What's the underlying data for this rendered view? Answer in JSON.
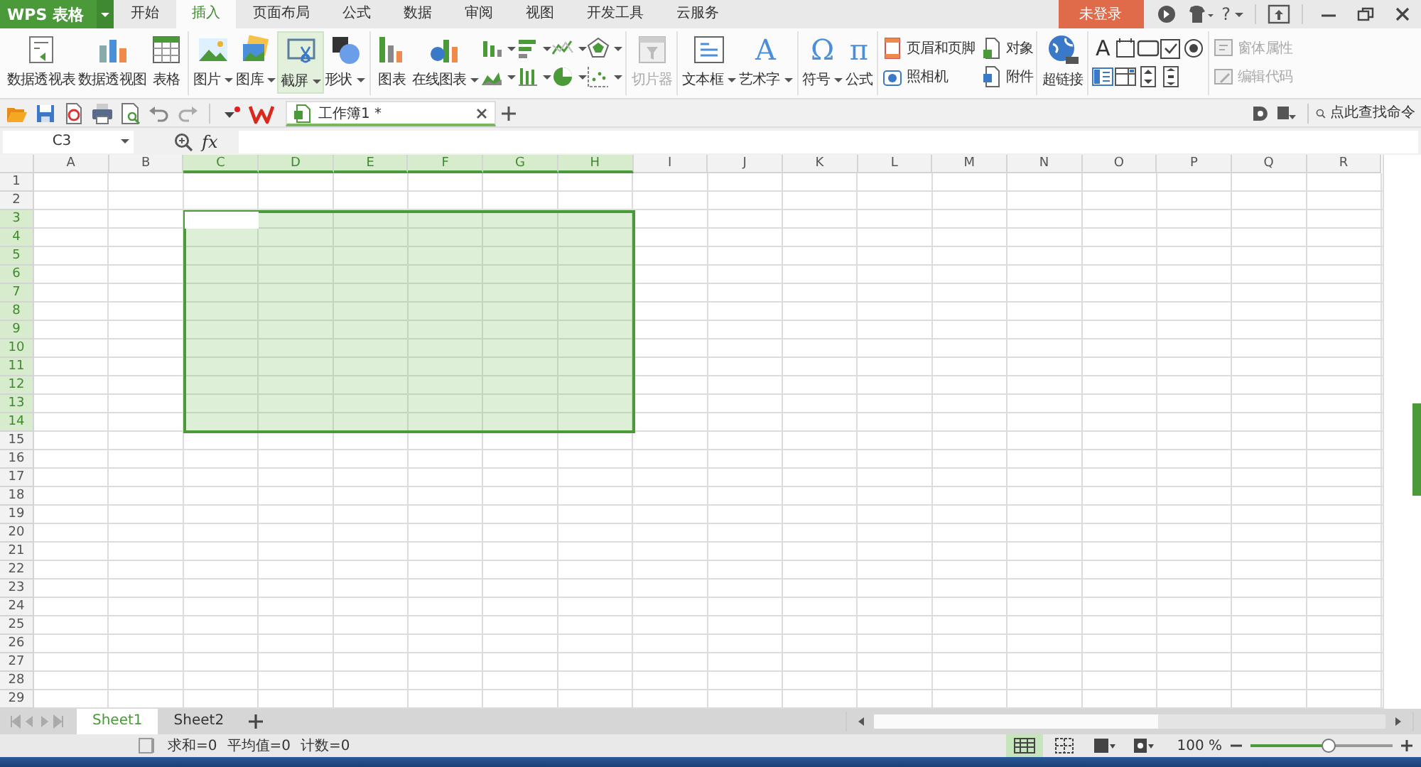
{
  "app": {
    "title": "WPS 表格",
    "login": "未登录",
    "help": "?"
  },
  "menu_tabs": [
    {
      "label": "开始",
      "selected": false
    },
    {
      "label": "插入",
      "selected": true
    },
    {
      "label": "页面布局",
      "selected": false
    },
    {
      "label": "公式",
      "selected": false
    },
    {
      "label": "数据",
      "selected": false
    },
    {
      "label": "审阅",
      "selected": false
    },
    {
      "label": "视图",
      "selected": false
    },
    {
      "label": "开发工具",
      "selected": false
    },
    {
      "label": "云服务",
      "selected": false
    }
  ],
  "ribbon": [
    {
      "items": [
        {
          "kind": "large",
          "label": "数据透视表",
          "dropdown": false,
          "pressed": false,
          "disabled": false
        },
        {
          "kind": "large",
          "label": "数据透视图",
          "dropdown": false,
          "pressed": false,
          "disabled": false
        },
        {
          "kind": "large",
          "label": "表格",
          "dropdown": false,
          "pressed": false,
          "disabled": false
        }
      ]
    },
    {
      "items": [
        {
          "kind": "large",
          "label": "图片",
          "dropdown": true,
          "pressed": false,
          "disabled": false
        },
        {
          "kind": "large",
          "label": "图库",
          "dropdown": true,
          "pressed": false,
          "disabled": false
        },
        {
          "kind": "large",
          "label": "截屏",
          "dropdown": true,
          "pressed": true,
          "disabled": false
        },
        {
          "kind": "large",
          "label": "形状",
          "dropdown": true,
          "pressed": false,
          "disabled": false
        }
      ]
    },
    {
      "items": [
        {
          "kind": "large",
          "label": "图表",
          "dropdown": false,
          "pressed": false,
          "disabled": false
        },
        {
          "kind": "large",
          "label": "在线图表",
          "dropdown": true,
          "pressed": false,
          "disabled": false
        },
        {
          "kind": "tool",
          "dropdown": true
        },
        {
          "kind": "tool",
          "dropdown": true
        },
        {
          "kind": "tool",
          "dropdown": true
        },
        {
          "kind": "tool",
          "dropdown": true
        },
        {
          "kind": "tool",
          "dropdown": true
        },
        {
          "kind": "tool",
          "dropdown": true
        },
        {
          "kind": "tool",
          "dropdown": true
        },
        {
          "kind": "tool",
          "dropdown": true
        }
      ]
    },
    {
      "items": [
        {
          "kind": "large",
          "label": "切片器",
          "dropdown": false,
          "pressed": false,
          "disabled": true
        }
      ]
    },
    {
      "items": [
        {
          "kind": "large",
          "label": "文本框",
          "dropdown": true,
          "pressed": false,
          "disabled": false
        },
        {
          "kind": "large",
          "label": "艺术字",
          "glyph": "A",
          "dropdown": true,
          "pressed": false,
          "disabled": false
        }
      ]
    },
    {
      "items": [
        {
          "kind": "large",
          "label": "符号",
          "glyph": "Ω",
          "dropdown": true,
          "pressed": false,
          "disabled": false
        },
        {
          "kind": "large",
          "label": "公式",
          "glyph": "π",
          "dropdown": false,
          "pressed": false,
          "disabled": false
        }
      ]
    },
    {
      "items": [
        {
          "kind": "small",
          "label": "页眉和页脚",
          "disabled": false
        },
        {
          "kind": "small",
          "label": "照相机",
          "disabled": false
        },
        {
          "kind": "small",
          "label": "对象",
          "disabled": false
        },
        {
          "kind": "small",
          "label": "附件",
          "disabled": false
        }
      ]
    },
    {
      "items": [
        {
          "kind": "large",
          "label": "超链接",
          "dropdown": false,
          "pressed": false,
          "disabled": false
        }
      ]
    },
    {
      "items": [
        {
          "kind": "tool",
          "glyph": "A",
          "dropdown": false
        },
        {
          "kind": "tool",
          "dropdown": false
        },
        {
          "kind": "tool",
          "dropdown": false
        },
        {
          "kind": "tool",
          "dropdown": false
        },
        {
          "kind": "tool",
          "dropdown": false
        },
        {
          "kind": "tool",
          "dropdown": false
        },
        {
          "kind": "tool",
          "dropdown": false
        },
        {
          "kind": "tool",
          "dropdown": false
        },
        {
          "kind": "tool",
          "dropdown": false
        }
      ]
    },
    {
      "items": [
        {
          "kind": "small",
          "label": "窗体属性",
          "disabled": true
        },
        {
          "kind": "small",
          "label": "编辑代码",
          "disabled": true
        }
      ]
    }
  ],
  "document_tab": {
    "title": "工作簿1 *"
  },
  "command_search": {
    "placeholder": "点此查找命令"
  },
  "formula_bar": {
    "name_box": "C3",
    "fx": "fx"
  },
  "columns": [
    {
      "label": "A",
      "selected": false
    },
    {
      "label": "B",
      "selected": false
    },
    {
      "label": "C",
      "selected": true
    },
    {
      "label": "D",
      "selected": true
    },
    {
      "label": "E",
      "selected": true
    },
    {
      "label": "F",
      "selected": true
    },
    {
      "label": "G",
      "selected": true
    },
    {
      "label": "H",
      "selected": true
    },
    {
      "label": "I",
      "selected": false
    },
    {
      "label": "J",
      "selected": false
    },
    {
      "label": "K",
      "selected": false
    },
    {
      "label": "L",
      "selected": false
    },
    {
      "label": "M",
      "selected": false
    },
    {
      "label": "N",
      "selected": false
    },
    {
      "label": "O",
      "selected": false
    },
    {
      "label": "P",
      "selected": false
    },
    {
      "label": "Q",
      "selected": false
    },
    {
      "label": "R",
      "selected": false
    }
  ],
  "rows": [
    {
      "label": "1",
      "selected": false
    },
    {
      "label": "2",
      "selected": false
    },
    {
      "label": "3",
      "selected": true
    },
    {
      "label": "4",
      "selected": true
    },
    {
      "label": "5",
      "selected": true
    },
    {
      "label": "6",
      "selected": true
    },
    {
      "label": "7",
      "selected": true
    },
    {
      "label": "8",
      "selected": true
    },
    {
      "label": "9",
      "selected": true
    },
    {
      "label": "10",
      "selected": true
    },
    {
      "label": "11",
      "selected": true
    },
    {
      "label": "12",
      "selected": true
    },
    {
      "label": "13",
      "selected": true
    },
    {
      "label": "14",
      "selected": true
    },
    {
      "label": "15",
      "selected": false
    },
    {
      "label": "16",
      "selected": false
    },
    {
      "label": "17",
      "selected": false
    },
    {
      "label": "18",
      "selected": false
    },
    {
      "label": "19",
      "selected": false
    },
    {
      "label": "20",
      "selected": false
    },
    {
      "label": "21",
      "selected": false
    },
    {
      "label": "22",
      "selected": false
    },
    {
      "label": "23",
      "selected": false
    },
    {
      "label": "24",
      "selected": false
    },
    {
      "label": "25",
      "selected": false
    },
    {
      "label": "26",
      "selected": false
    },
    {
      "label": "27",
      "selected": false
    },
    {
      "label": "28",
      "selected": false
    },
    {
      "label": "29",
      "selected": false
    }
  ],
  "sheet_tabs": [
    {
      "label": "Sheet1",
      "selected": true
    },
    {
      "label": "Sheet2",
      "selected": false
    }
  ],
  "status_bar": {
    "items": [
      "求和=0",
      "平均值=0",
      "计数=0"
    ],
    "views": [
      {
        "selected": true
      },
      {
        "selected": false
      },
      {
        "selected": false
      },
      {
        "selected": false
      }
    ],
    "zoom": "100 %",
    "zoom_level": {
      "level": 0.55
    }
  }
}
